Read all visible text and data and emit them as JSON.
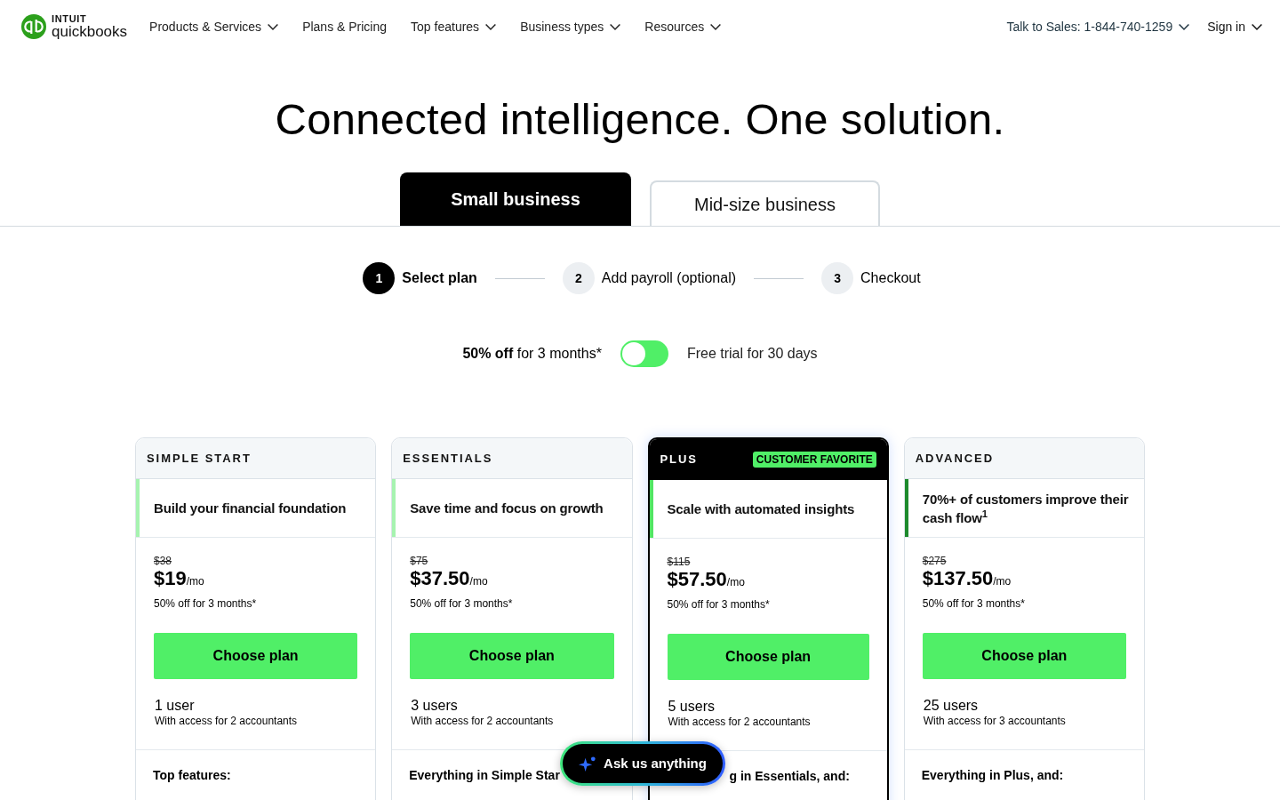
{
  "header": {
    "logo": {
      "brand": "INTUIT",
      "product": "quickbooks"
    },
    "nav": [
      {
        "label": "Products & Services",
        "has_menu": true
      },
      {
        "label": "Plans & Pricing",
        "has_menu": false
      },
      {
        "label": "Top features",
        "has_menu": true
      },
      {
        "label": "Business types",
        "has_menu": true
      },
      {
        "label": "Resources",
        "has_menu": true
      }
    ],
    "actions": [
      {
        "label": "Talk to Sales: 1-844-740-1259",
        "has_menu": true
      },
      {
        "label": "Sign in",
        "has_menu": true
      }
    ]
  },
  "headline": "Connected intelligence. One solution.",
  "tabs": [
    {
      "label": "Small business",
      "selected": true
    },
    {
      "label": "Mid-size business",
      "selected": false
    }
  ],
  "steps": [
    {
      "number": "1",
      "label": "Select plan",
      "selected": true
    },
    {
      "number": "2",
      "label": "Add payroll (optional)",
      "selected": false
    },
    {
      "number": "3",
      "label": "Checkout",
      "selected": false
    }
  ],
  "billing_toggle": {
    "left_label": "**50% off** for 3 months*",
    "right_label": "Free trial for 30 days",
    "on": false
  },
  "plans": [
    {
      "name": "SIMPLE START",
      "featured": false,
      "color": "#a6f3b0",
      "tagline": "Build your financial foundation",
      "old_price": "$38",
      "price": "$19",
      "period": "/mo",
      "discount_note": "50% off for 3 months*",
      "button": "Choose plan",
      "users": "1 user",
      "accountants": "With access for 2 accountants",
      "features_heading": "Top features:",
      "features_heading_cut_left": false
    },
    {
      "name": "ESSENTIALS",
      "featured": false,
      "color": "#a6f3b0",
      "tagline": "Save time and focus on growth",
      "old_price": "$75",
      "price": "$37.50",
      "period": "/mo",
      "discount_note": "50% off for 3 months*",
      "button": "Choose plan",
      "users": "3 users",
      "accountants": "With access for 2 accountants",
      "features_heading": "Everything in Simple Star",
      "features_heading_cut_left": false
    },
    {
      "name": "PLUS",
      "badge": "CUSTOMER FAVORITE",
      "featured": true,
      "color": "#52e563",
      "tagline": "Scale with automated insights",
      "old_price": "$115",
      "price": "$57.50",
      "period": "/mo",
      "discount_note": "50% off for 3 months*",
      "button": "Choose plan",
      "users": "5 users",
      "accountants": "With access for 2 accountants",
      "features_heading": "g in Essentials, and:",
      "features_heading_cut_left": true
    },
    {
      "name": "ADVANCED",
      "featured": false,
      "color": "#1d8a2c",
      "tagline": "70%+ of customers improve their cash flow$^{1}$",
      "old_price": "$275",
      "price": "$137.50",
      "period": "/mo",
      "discount_note": "50% off for 3 months*",
      "button": "Choose plan",
      "users": "25 users",
      "accountants": "With access for 3 accountants",
      "features_heading": "Everything in Plus, and:",
      "features_heading_cut_left": false
    }
  ],
  "chat_button": {
    "label": "Ask us anything"
  }
}
